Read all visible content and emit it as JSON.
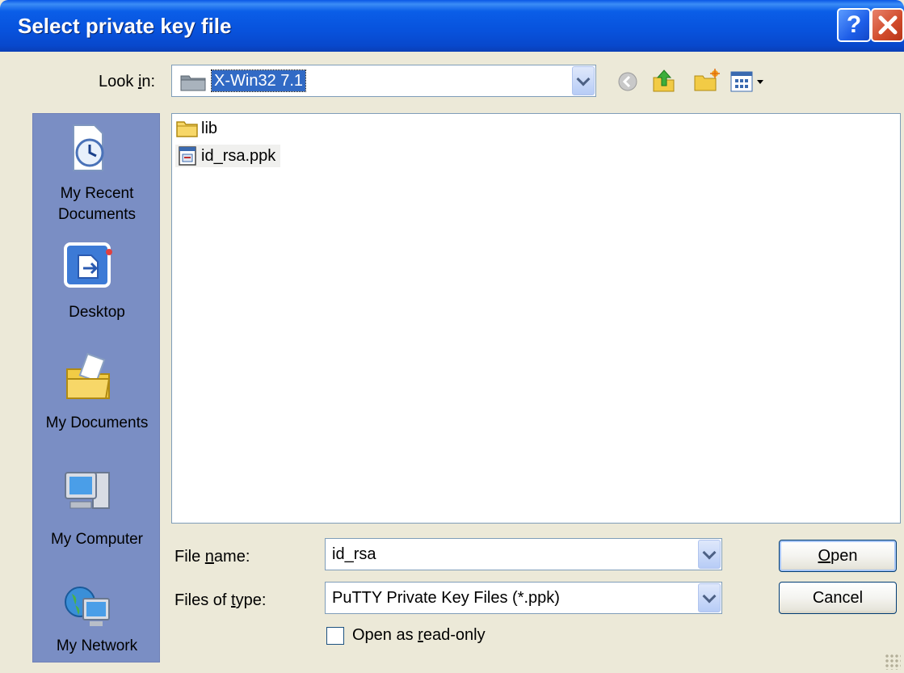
{
  "dialog": {
    "title": "Select private key file",
    "help_glyph": "?",
    "close_glyph": "✕"
  },
  "lookin": {
    "label_pre": "Look ",
    "label_u": "i",
    "label_post": "n:",
    "value": "X-Win32 7.1"
  },
  "toolbar": {
    "icons": [
      "back-icon",
      "up-folder-icon",
      "new-folder-icon",
      "view-menu-icon"
    ]
  },
  "places": [
    {
      "label": "My Recent\nDocuments",
      "icon": "recent-documents-icon"
    },
    {
      "label": "Desktop",
      "icon": "desktop-icon"
    },
    {
      "label": "My Documents",
      "icon": "my-documents-icon"
    },
    {
      "label": "My Computer",
      "icon": "my-computer-icon"
    },
    {
      "label": "My Network",
      "icon": "my-network-icon"
    }
  ],
  "files": [
    {
      "name": "lib",
      "icon": "folder-icon"
    },
    {
      "name": "id_rsa.ppk",
      "icon": "ppk-file-icon"
    }
  ],
  "filename": {
    "label_pre": "File ",
    "label_u": "n",
    "label_post": "ame:",
    "value": "id_rsa"
  },
  "filetype": {
    "label_pre": "Files of ",
    "label_u": "t",
    "label_post": "ype:",
    "value": "PuTTY Private Key Files (*.ppk)"
  },
  "readonly": {
    "label_pre": "Open as ",
    "label_u": "r",
    "label_post": "ead-only",
    "checked": false
  },
  "buttons": {
    "open_u": "O",
    "open_rest": "pen",
    "cancel": "Cancel"
  },
  "colors": {
    "titlebar": "#0852dc",
    "places_bar": "#7a8ec4",
    "face": "#ece9d8"
  }
}
